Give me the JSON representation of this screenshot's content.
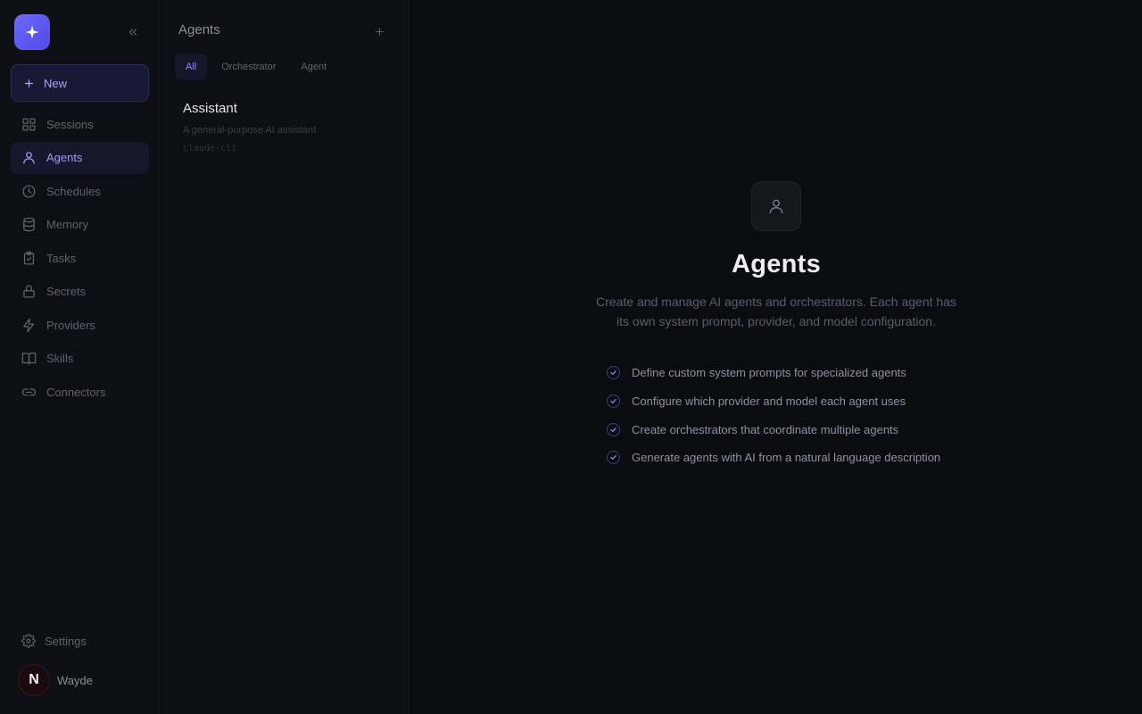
{
  "sidebar": {
    "new_label": "New",
    "items": [
      {
        "label": "Sessions",
        "icon": "grid-icon"
      },
      {
        "label": "Agents",
        "icon": "user-icon",
        "active": true
      },
      {
        "label": "Schedules",
        "icon": "clock-icon"
      },
      {
        "label": "Memory",
        "icon": "database-icon"
      },
      {
        "label": "Tasks",
        "icon": "clipboard-check-icon"
      },
      {
        "label": "Secrets",
        "icon": "lock-icon"
      },
      {
        "label": "Providers",
        "icon": "bolt-icon"
      },
      {
        "label": "Skills",
        "icon": "book-icon"
      },
      {
        "label": "Connectors",
        "icon": "link-icon"
      }
    ],
    "settings_label": "Settings",
    "user": {
      "name": "Wayde",
      "avatar_letter": "N"
    }
  },
  "agents_panel": {
    "title": "Agents",
    "filters": [
      "All",
      "Orchestrator",
      "Agent"
    ],
    "active_filter": "All",
    "agents": [
      {
        "name": "Assistant",
        "description": "A general-purpose AI assistant",
        "provider": "claude-cli"
      }
    ]
  },
  "main": {
    "title": "Agents",
    "description": "Create and manage AI agents and orchestrators. Each agent has its own system prompt, provider, and model configuration.",
    "features": [
      "Define custom system prompts for specialized agents",
      "Configure which provider and model each agent uses",
      "Create orchestrators that coordinate multiple agents",
      "Generate agents with AI from a natural language description"
    ]
  },
  "colors": {
    "accent": "#6d6af7",
    "active_bg": "#16172a",
    "background": "#0b0c10"
  }
}
